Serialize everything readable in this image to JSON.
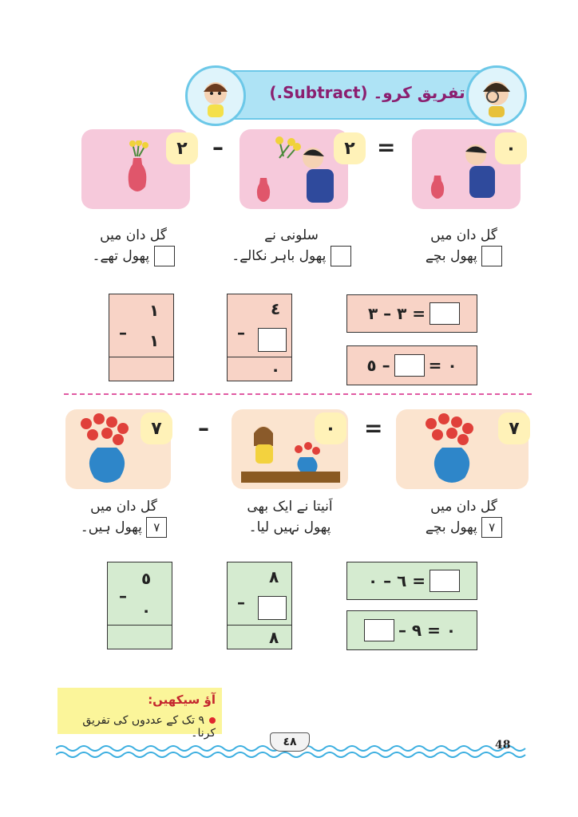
{
  "banner": {
    "title": "تفریق کرو۔ (Subtract.)"
  },
  "section1": {
    "cards": [
      {
        "number": "٠"
      },
      {
        "number": "٢"
      },
      {
        "number": "٢"
      }
    ],
    "operators": {
      "equals": "=",
      "minus": "–"
    },
    "captions": [
      {
        "line1": "گل دان میں",
        "line2": "پھول بچے"
      },
      {
        "line1": "سلونی نے",
        "line2": "پھول باہر نکالے۔"
      },
      {
        "line1": "گل دان میں",
        "line2": "پھول تھے۔"
      }
    ],
    "column_a": {
      "top": "١",
      "minus": "–",
      "bottom": "١"
    },
    "column_b": {
      "top": "٤",
      "minus": "–",
      "result": "٠"
    },
    "equations": [
      {
        "left": "٣ – ٣ ="
      },
      {
        "a": "٥ –",
        "b": "= ٠"
      }
    ]
  },
  "section2": {
    "cards": [
      {
        "number": "٧"
      },
      {
        "number": "٠"
      },
      {
        "number": "٧"
      }
    ],
    "operators": {
      "equals": "=",
      "minus": "–"
    },
    "captions": [
      {
        "line1": "گل دان میں",
        "line2": "پھول بچے",
        "value": "٧"
      },
      {
        "line1": "اَنیتا نے ایک بھی",
        "line2": "پھول نہیں لیا۔"
      },
      {
        "line1": "گل دان میں",
        "line2": "پھول ہیں۔",
        "value": "٧"
      }
    ],
    "column_a": {
      "top": "٥",
      "minus": "–",
      "bottom": "٠"
    },
    "column_b": {
      "top": "٨",
      "minus": "–",
      "result": "٨"
    },
    "equations": [
      {
        "left": "٦ – ٠ ="
      },
      {
        "right": "– ٠ = ٩"
      }
    ]
  },
  "note": {
    "title": "آؤ سیکھیں:",
    "text": "٩ تک کے عددوں کی تفریق کرنا۔"
  },
  "footer": {
    "page_urdu": "٤٨",
    "page_number": "48"
  },
  "colors": {
    "pink_card": "#f6c9db",
    "peach_card": "#fbe4cf",
    "pink_box": "#f8d3c6",
    "green_box": "#d5ebd0",
    "badge": "#fff2b8",
    "title_text": "#8b1f70",
    "divider": "#e05aa3"
  }
}
